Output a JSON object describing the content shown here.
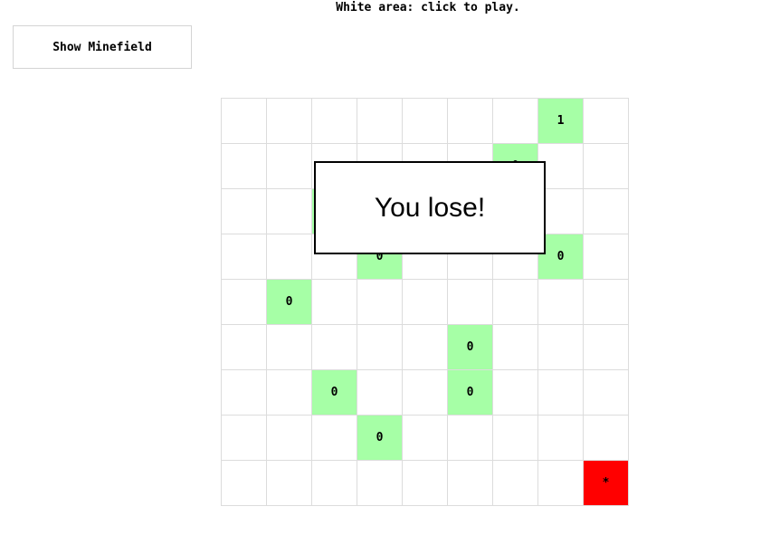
{
  "instructions": "White area: click to play.",
  "show_minefield_label": "Show Minefield",
  "message": "You lose!",
  "colors": {
    "revealed": "#a6ffa6",
    "mine": "#ff0000",
    "grid_line": "#dcdcdc"
  },
  "board": {
    "rows": 9,
    "cols": 9,
    "cells": [
      [
        "",
        "",
        "",
        "",
        "",
        "",
        "",
        "1",
        ""
      ],
      [
        "",
        "",
        "",
        "",
        "",
        "",
        "0",
        "",
        ""
      ],
      [
        "",
        "",
        "0",
        "",
        "",
        "",
        "",
        "",
        ""
      ],
      [
        "",
        "",
        "",
        "0",
        "",
        "",
        "",
        "0",
        ""
      ],
      [
        "",
        "0",
        "",
        "",
        "",
        "",
        "",
        "",
        ""
      ],
      [
        "",
        "",
        "",
        "",
        "",
        "0",
        "",
        "",
        ""
      ],
      [
        "",
        "",
        "0",
        "",
        "",
        "0",
        "",
        "",
        ""
      ],
      [
        "",
        "",
        "",
        "0",
        "",
        "",
        "",
        "",
        ""
      ],
      [
        "",
        "",
        "",
        "",
        "",
        "",
        "",
        "",
        "*"
      ]
    ]
  }
}
